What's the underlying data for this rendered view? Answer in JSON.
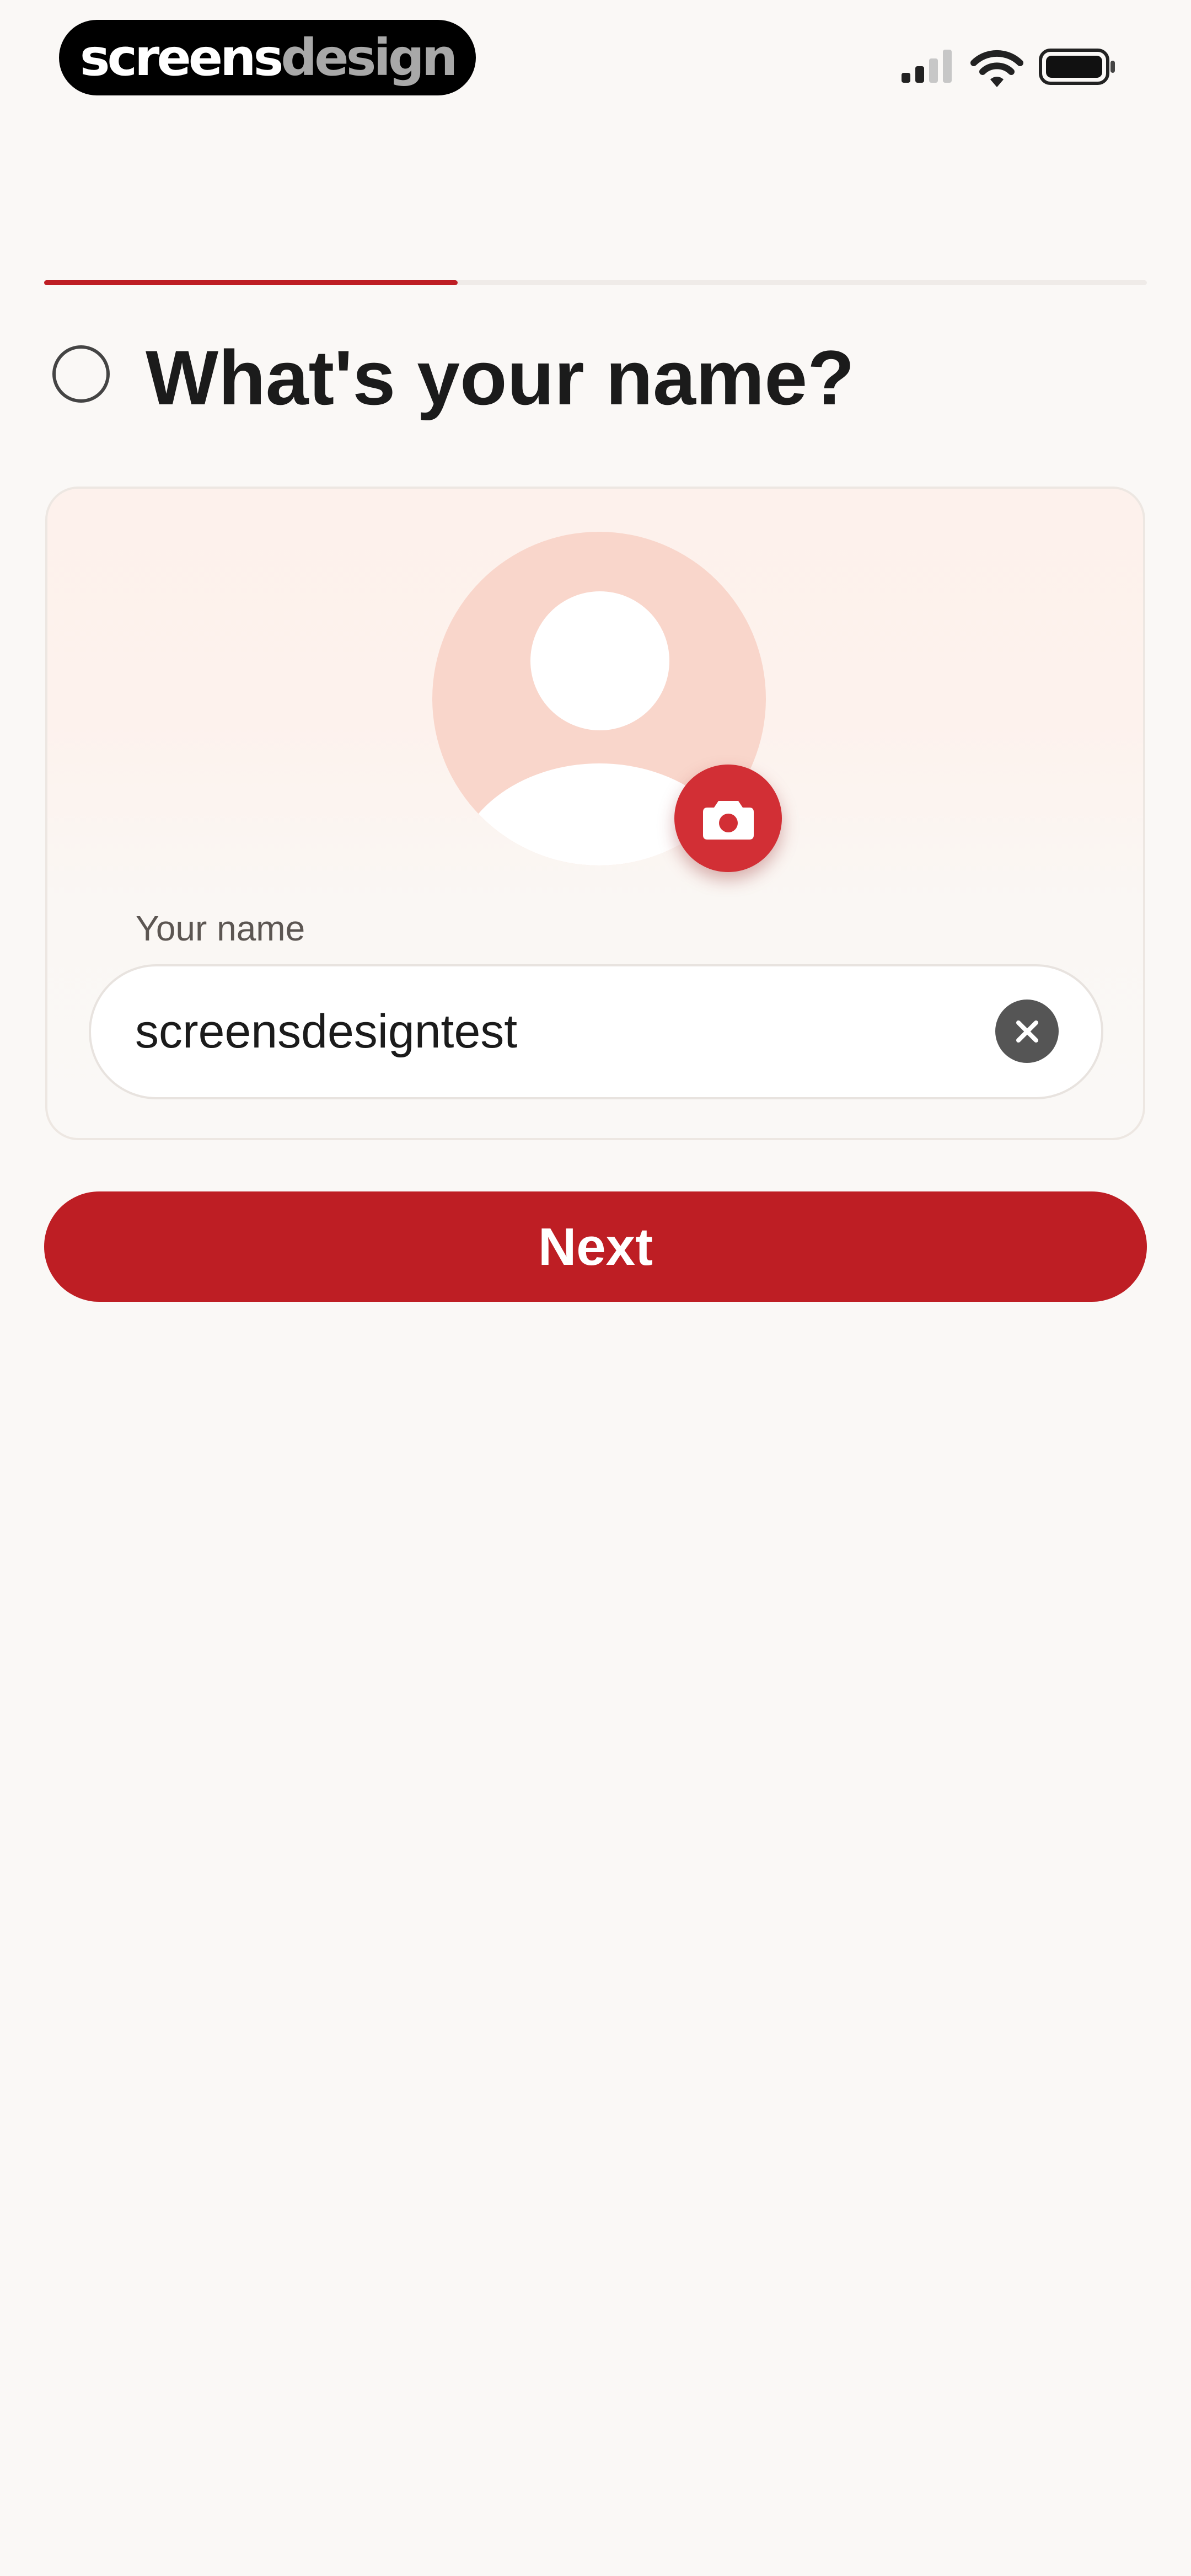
{
  "status_bar": {
    "brand_part_a": "screens",
    "brand_part_b": "design",
    "signal_icon": "cellular-signal-icon",
    "wifi_icon": "wifi-icon",
    "battery_icon": "battery-icon"
  },
  "progress": {
    "fraction": 0.375
  },
  "header": {
    "title": "What's your name?",
    "radio_icon": "radio-unchecked-icon"
  },
  "profile": {
    "avatar_icon": "user-avatar-icon",
    "camera_icon": "camera-icon",
    "name_label": "Your name",
    "name_value": "screensdesigntest",
    "clear_icon": "clear-x-icon"
  },
  "actions": {
    "next_label": "Next"
  },
  "colors": {
    "accent": "#be1e24",
    "camera": "#d22f35",
    "avatar": "#f9d6cb",
    "background": "#faf8f6"
  }
}
